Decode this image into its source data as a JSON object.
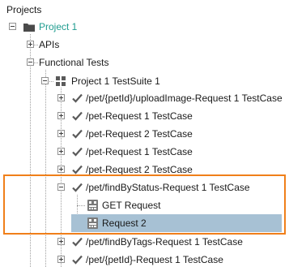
{
  "panel": {
    "title": "Projects"
  },
  "colors": {
    "accent": "#f07f1a",
    "selection": "#a7c1d4",
    "project_text": "#1f9c8f"
  },
  "tree": {
    "project": {
      "label": "Project 1",
      "icon": "folder-icon"
    },
    "apis": {
      "label": "APIs"
    },
    "functional_tests": {
      "label": "Functional Tests"
    },
    "suite": {
      "label": "Project 1 TestSuite 1",
      "icon": "testsuite-icon"
    },
    "testcases": [
      {
        "label": "/pet/{petId}/uploadImage-Request 1 TestCase",
        "icon": "check-icon"
      },
      {
        "label": "/pet-Request 1 TestCase",
        "icon": "check-icon"
      },
      {
        "label": "/pet-Request 2 TestCase",
        "icon": "check-icon"
      },
      {
        "label": "/pet-Request 1 TestCase",
        "icon": "check-icon"
      },
      {
        "label": "/pet-Request 2 TestCase",
        "icon": "check-icon"
      },
      {
        "label": "/pet/findByStatus-Request 1 TestCase",
        "icon": "check-icon",
        "expanded": true
      },
      {
        "label": "/pet/findByTags-Request 1 TestCase",
        "icon": "check-icon"
      },
      {
        "label": "/pet/{petId}-Request 1 TestCase",
        "icon": "check-icon"
      }
    ],
    "requests": [
      {
        "label": "GET Request",
        "icon": "request-icon"
      },
      {
        "label": "Request 2",
        "icon": "request-icon",
        "selected": true
      }
    ]
  }
}
